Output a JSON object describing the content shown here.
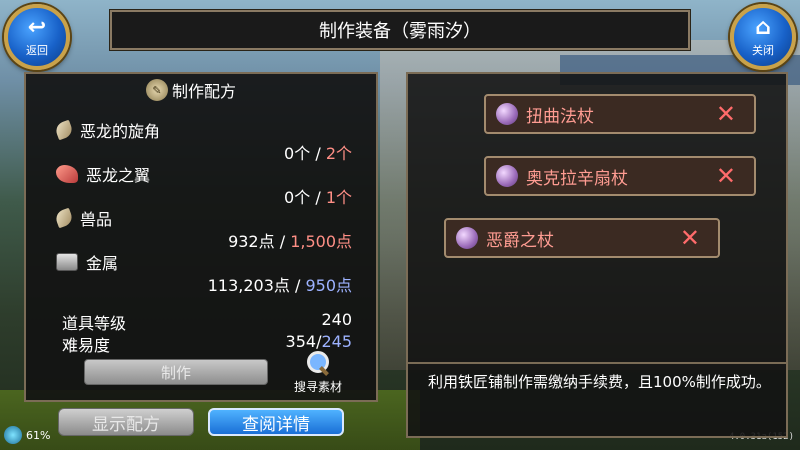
{
  "header": {
    "title": "制作装备（雾雨汐）",
    "back_label": "返回",
    "close_label": "关闭"
  },
  "recipe": {
    "section_title": "制作配方",
    "materials": [
      {
        "name": "恶龙的旋角",
        "icon": "horn-icon",
        "have": "0个",
        "sep": "/",
        "need": "2个",
        "need_color": "#ff8f86"
      },
      {
        "name": "恶龙之翼",
        "icon": "wing-icon",
        "have": "0个",
        "sep": "/",
        "need": "1个",
        "need_color": "#ff8f86"
      },
      {
        "name": "兽品",
        "icon": "horn-icon",
        "have": "932点",
        "sep": "/",
        "need": "1,500点",
        "need_color": "#ff8f86"
      },
      {
        "name": "金属",
        "icon": "metal-icon",
        "have": "113,203点",
        "sep": "/",
        "need": "950点",
        "need_color": "#9db2ff"
      }
    ],
    "item_level_label": "道具等级",
    "item_level_value": "240",
    "difficulty_label": "难易度",
    "difficulty_have": "354",
    "difficulty_sep": "/",
    "difficulty_need": "245",
    "craft_button": "制作",
    "search_materials": "搜寻素材"
  },
  "bottom": {
    "show_recipe": "显示配方",
    "view_details": "查阅详情",
    "battery": "61%",
    "version": "4.0.31a(152)"
  },
  "right": {
    "items": [
      {
        "name": "扭曲法杖",
        "remove": "✕"
      },
      {
        "name": "奥克拉辛扇杖",
        "remove": "✕"
      },
      {
        "name": "恶爵之杖",
        "remove": "✕"
      }
    ],
    "notice": "利用铁匠铺制作需缴纳手续费，且100%制作成功。"
  },
  "colors": {
    "need_insufficient": "#ff8f86",
    "need_sufficient": "#9db2ff",
    "accent_blue": "#1a6fd6",
    "panel_border": "#7b6c56"
  }
}
